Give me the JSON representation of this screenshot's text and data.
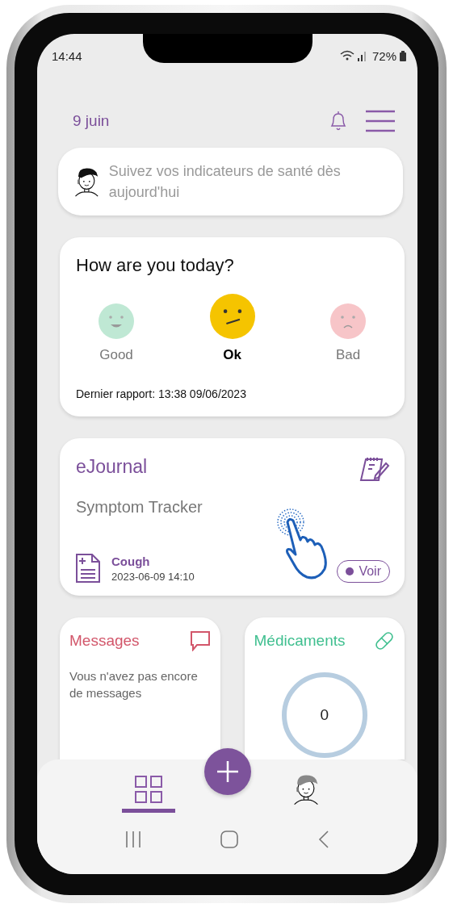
{
  "status_bar": {
    "time": "14:44",
    "battery": "72%"
  },
  "header": {
    "date": "9 juin"
  },
  "banner": {
    "text": "Suivez vos indicateurs de santé dès aujourd'hui"
  },
  "mood": {
    "title": "How are you today?",
    "options": [
      {
        "kind": "happy",
        "label": "Good",
        "selected": false,
        "color": "#bfe8d4"
      },
      {
        "kind": "neutral",
        "label": "Ok",
        "selected": true,
        "color": "#f5c400"
      },
      {
        "kind": "sad",
        "label": "Bad",
        "selected": false,
        "color": "#f7c5c8"
      }
    ],
    "last_report": "Dernier rapport: 13:38 09/06/2023"
  },
  "ejournal": {
    "title": "eJournal",
    "subtitle": "Symptom Tracker",
    "entry": {
      "name": "Cough",
      "datetime": "2023-06-09 14:10"
    },
    "button": "Voir"
  },
  "messages": {
    "title": "Messages",
    "text": "Vous n'avez pas encore de messages"
  },
  "medications": {
    "title": "Médicaments",
    "count": "0"
  },
  "bottom_nav": {
    "tabs": [
      {
        "kind": "dashboard",
        "selected": true
      },
      {
        "kind": "profile",
        "selected": false
      }
    ]
  }
}
